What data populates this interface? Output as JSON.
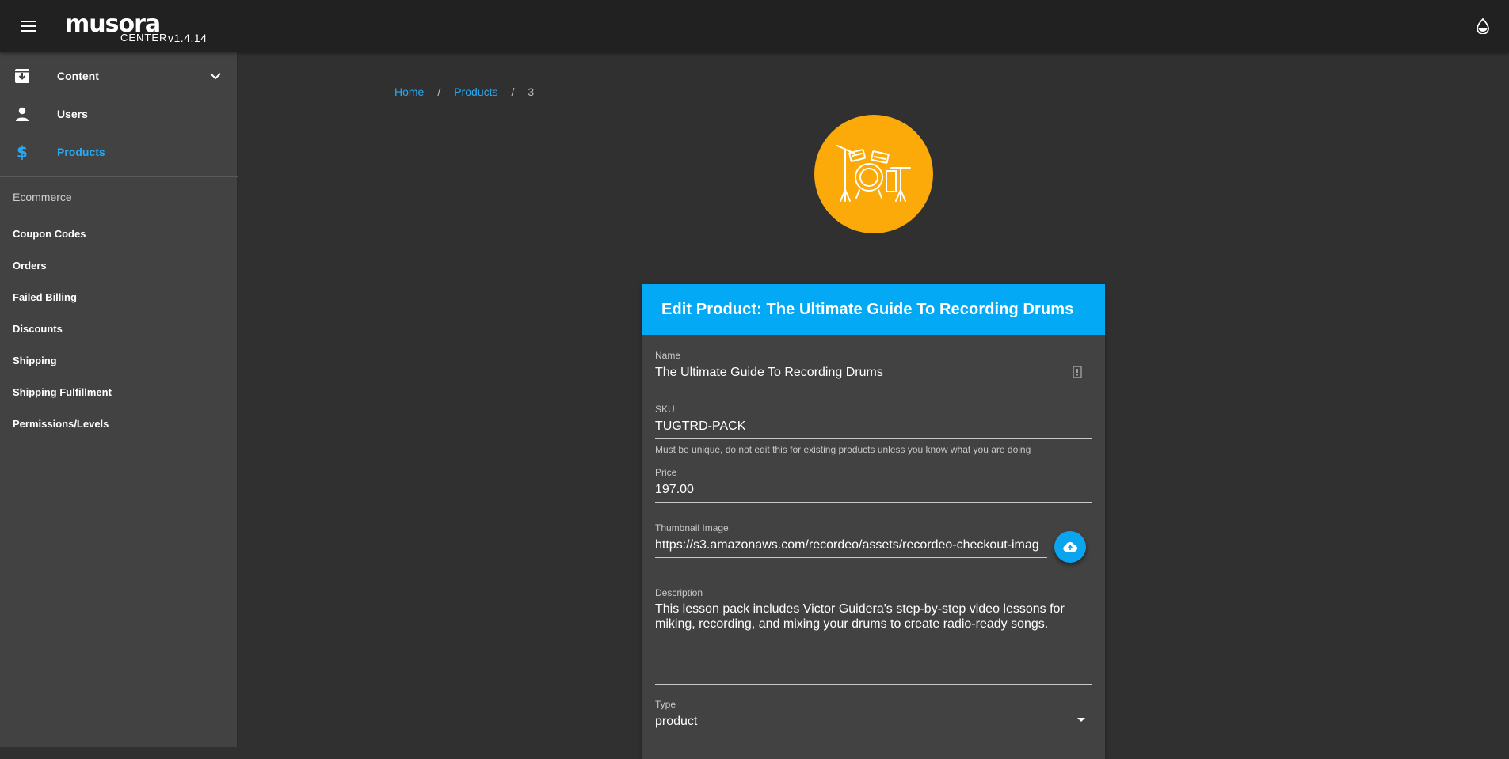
{
  "app": {
    "logo_word": "musora",
    "logo_sub": "CENTER",
    "version": "v1.4.14"
  },
  "sidebar": {
    "items": [
      {
        "label": "Content",
        "icon": "archive-icon",
        "expandable": true
      },
      {
        "label": "Users",
        "icon": "person-icon"
      },
      {
        "label": "Products",
        "icon": "dollar-icon",
        "active": true
      }
    ],
    "section_title": "Ecommerce",
    "ecommerce_items": [
      {
        "label": "Coupon Codes"
      },
      {
        "label": "Orders"
      },
      {
        "label": "Failed Billing"
      },
      {
        "label": "Discounts"
      },
      {
        "label": "Shipping"
      },
      {
        "label": "Shipping Fulfillment"
      },
      {
        "label": "Permissions/Levels"
      }
    ]
  },
  "breadcrumb": {
    "home": "Home",
    "products": "Products",
    "current": "3",
    "separator": "/"
  },
  "product_avatar": {
    "icon": "drum-kit-icon",
    "color": "#fca90a"
  },
  "form": {
    "title": "Edit Product: The Ultimate Guide To Recording Drums",
    "header_color": "#03a9f4",
    "name": {
      "label": "Name",
      "value": "The Ultimate Guide To Recording Drums"
    },
    "sku": {
      "label": "SKU",
      "value": "TUGTRD-PACK",
      "hint": "Must be unique, do not edit this for existing products unless you know what you are doing"
    },
    "price": {
      "label": "Price",
      "value": "197.00"
    },
    "thumbnail": {
      "label": "Thumbnail Image",
      "value": "https://s3.amazonaws.com/recordeo/assets/recordeo-checkout-imag"
    },
    "description": {
      "label": "Description",
      "value": "This lesson pack includes Victor Guidera's step-by-step video lessons for miking, recording, and mixing your drums to create radio-ready songs."
    },
    "type": {
      "label": "Type",
      "value": "product"
    }
  },
  "colors": {
    "accent": "#29a8f2",
    "appbar": "#212121",
    "sidebar": "#424242",
    "background": "#303030"
  }
}
